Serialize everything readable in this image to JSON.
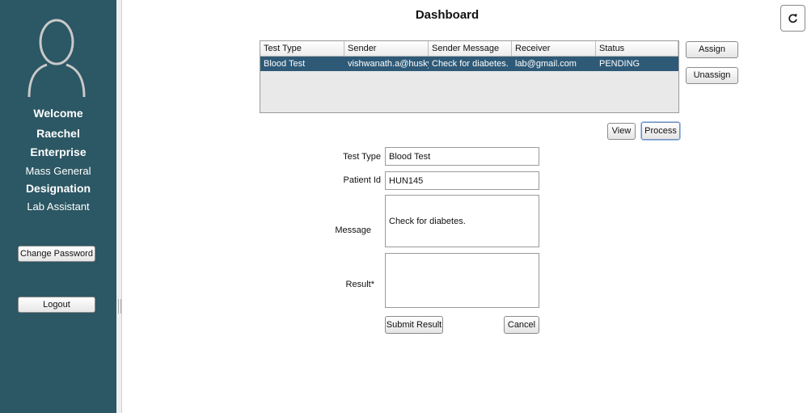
{
  "sidebar": {
    "welcome": "Welcome",
    "user_name": "Raechel",
    "enterprise_label": "Enterprise",
    "enterprise_value": "Mass General",
    "designation_label": "Designation",
    "designation_value": "Lab Assistant",
    "change_password_label": "Change Password",
    "logout_label": "Logout",
    "avatar_icon": "user-avatar-icon"
  },
  "header": {
    "title": "Dashboard",
    "refresh_icon": "refresh-icon"
  },
  "table": {
    "columns": [
      "Test Type",
      "Sender",
      "Sender Message",
      "Receiver",
      "Status"
    ],
    "rows": [
      [
        "Blood Test",
        "vishwanath.a@husky....",
        "Check for diabetes.",
        "lab@gmail.com",
        "PENDING"
      ]
    ]
  },
  "actions": {
    "assign_label": "Assign",
    "unassign_label": "Unassign",
    "view_label": "View",
    "process_label": "Process"
  },
  "form": {
    "test_type_label": "Test Type",
    "test_type_value": "Blood Test",
    "patient_id_label": "Patient Id",
    "patient_id_value": "HUN145",
    "message_label": "Message",
    "message_value": "Check for diabetes.",
    "result_label": "Result*",
    "result_value": "",
    "submit_label": "Submit Result",
    "cancel_label": "Cancel"
  },
  "colors": {
    "sidebar_bg": "#2c5764",
    "selected_row_bg": "#2e5a78"
  }
}
